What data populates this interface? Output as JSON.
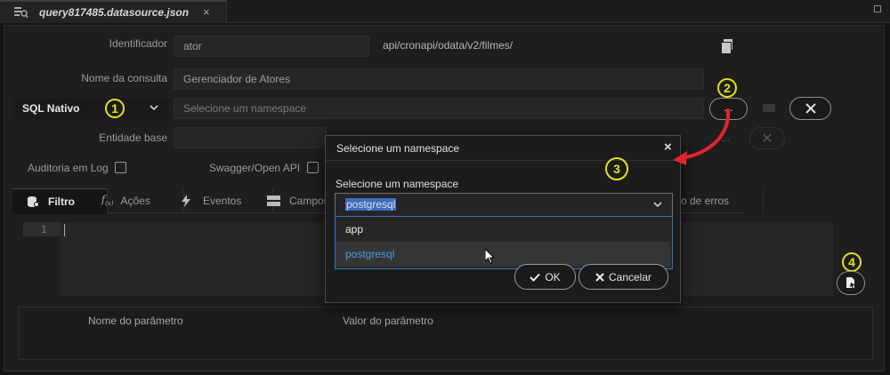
{
  "tab": {
    "filename": "query817485.datasource.json",
    "close": "×"
  },
  "form": {
    "identificador_label": "Identificador",
    "identificador_value": "ator",
    "api_path": "api/cronapi/odata/v2/filmes/",
    "nome_consulta_label": "Nome da consulta",
    "nome_consulta_value": "Gerenciador de Atores",
    "mode_select": "SQL Nativo",
    "namespace_placeholder": "Selecione um namespace",
    "ellipsis": "...",
    "entidade_label": "Entidade base",
    "auditoria_label": "Auditoria em Log",
    "swagger_label": "Swagger/Open API"
  },
  "subtabs": [
    {
      "label": "Filtro",
      "icon": "database-icon"
    },
    {
      "label": "Ações",
      "icon": "function-icon"
    },
    {
      "label": "Eventos",
      "icon": "lightning-icon"
    },
    {
      "label": "Campos",
      "icon": "table-icon"
    },
    {
      "label": "o de erros",
      "icon": ""
    }
  ],
  "editor": {
    "line_number": "1"
  },
  "params": {
    "col_name": "Nome do parâmetro",
    "col_value": "Valor do parâmetro"
  },
  "modal": {
    "title": "Selecione um namespace",
    "close": "×",
    "field_label": "Selecione um namespace",
    "selected": "postgresql",
    "options": [
      "app",
      "postgresql"
    ],
    "ok_label": "OK",
    "cancel_label": "Cancelar"
  },
  "annotations": [
    "1",
    "2",
    "3",
    "4"
  ],
  "colors": {
    "highlight": "#e4e21a",
    "arrow": "#e3242b",
    "link_blue": "#4a9be8"
  }
}
